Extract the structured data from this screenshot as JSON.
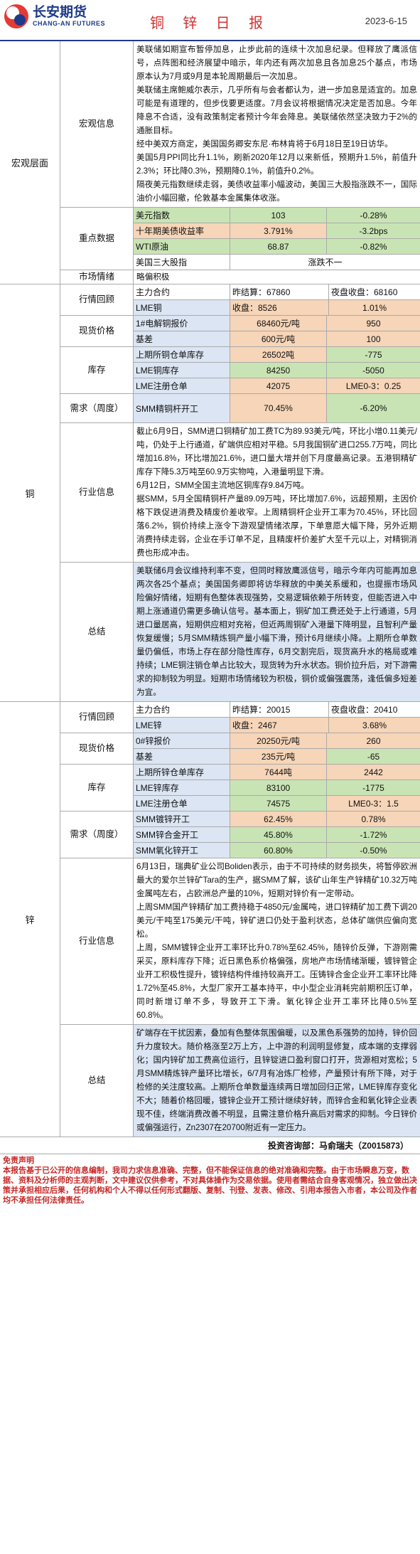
{
  "header": {
    "company_cn": "长安期货",
    "company_en": "CHANG-AN FUTURES",
    "title": "铜 锌 日 报",
    "date": "2023-6-15"
  },
  "macro": {
    "section_label": "宏观层面",
    "news_label": "宏观信息",
    "news_paragraphs": [
      "美联储如期宣布暂停加息，止步此前的连续十次加息纪录。但释放了鹰派信号，点阵图和经济展望中暗示，年内还有两次加息且各加息25个基点，市场原本认为7月或9月是本轮周期最后一次加息。",
      "美联储主席鲍威尔表示，几乎所有与会者都认为，进一步加息是适宜的。加息可能是有道理的，但步伐要更适度。7月会议将根据情况决定是否加息。今年降息不合适，没有政策制定者预计今年会降息。美联储依然坚决致力于2%的通胀目标。",
      "经中美双方商定，美国国务卿安东尼·布林肯将于6月18日至19日访华。",
      "美国5月PPI同比升1.1%，刷新2020年12月以来新低，预期升1.5%，前值升2.3%；环比降0.3%，预期降0.1%，前值升0.2%。",
      "隔夜美元指数继续走弱，美债收益率小幅波动，美国三大股指涨跌不一，国际油价小幅回撤，伦敦基本金属集体收涨。"
    ],
    "key_label": "重点数据",
    "key_rows": [
      {
        "name": "美元指数",
        "value": "103",
        "change": "-0.28%"
      },
      {
        "name": "十年期美债收益率",
        "value": "3.791%",
        "change": "-3.2bps"
      },
      {
        "name": "WTI原油",
        "value": "68.87",
        "change": "-0.82%"
      },
      {
        "name": "美国三大股指",
        "value": "涨跌不一"
      }
    ],
    "sentiment_label": "市场情绪",
    "sentiment_value": "略偏积极"
  },
  "copper": {
    "section_label": "铜",
    "quote_label": "行情回顾",
    "quote_rows": [
      {
        "c1": "主力合约",
        "c2": "昨结算：67860",
        "c3": "夜盘收盘：68160"
      },
      {
        "c1": "LME铜",
        "c2": "收盘：8526",
        "c3": "1.01%"
      }
    ],
    "spot_label": "现货价格",
    "spot_rows": [
      {
        "c1": "1#电解铜报价",
        "c2": "68460元/吨",
        "c3": "950"
      },
      {
        "c1": "基差",
        "c2": "600元/吨",
        "c3": "100"
      }
    ],
    "stock_label": "库存",
    "stock_rows": [
      {
        "c1": "上期所铜仓单库存",
        "c2": "26502吨",
        "c3": "-775"
      },
      {
        "c1": "LME铜库存",
        "c2": "84250",
        "c3": "-5050"
      },
      {
        "c1": "LME注册仓单",
        "c2": "42075",
        "c3": "LME0-3：0.25"
      }
    ],
    "demand_label": "需求（周度）",
    "demand_rows": [
      {
        "c1": "SMM精铜杆开工",
        "c2": "70.45%",
        "c3": "-6.20%"
      }
    ],
    "industry_label": "行业信息",
    "industry_paragraphs": [
      "截止6月9日，SMM进口铜精矿加工费TC为89.93美元/吨，环比小增0.11美元/吨，仍处于上行通道，矿端供应相对平稳。5月我国铜矿进口255.7万吨，同比增加16.8%，环比增加21.6%，进口量大增并创下月度最高记录。五港铜精矿库存下降5.3万吨至60.9万实物吨，入港量明显下滑。",
      "6月12日，SMM全国主流地区铜库存9.84万吨。",
      "据SMM，5月全国精铜杆产量89.09万吨，环比增加7.6%，远超预期，主因价格下跌促进消费及精废价差收窄。上周精铜杆企业开工率为70.45%，环比回落6.2%，铜价持续上涨令下游观望情绪浓厚，下单意愿大幅下降，另外近期消费持续走弱，企业在手订单不足，且精废杆价差扩大至千元以上，对精铜消费也形成冲击。"
    ],
    "summary_label": "总结",
    "summary_paragraphs": [
      "美联储6月会议维持利率不变，但同时释放鹰派信号，暗示今年内可能再加息两次各25个基点；美国国务卿即将访华释放的中美关系缓和，也提振市场风险偏好情绪，短期有色整体表现强势，交易逻辑依赖于所转变，但能否进入中期上涨通道仍需更多确认信号。基本面上，铜矿加工费还处于上行通道，5月进口量居高，短期供应相对充裕，但近两周铜矿入港量下降明显，且智利产量恢复缓慢；5月SMM精炼铜产量小幅下滑，预计6月继续小降。上期所仓单数量仍偏低，市场上存在部分隐性库存，6月交割完后，现货高升水的格局或难持续；LME铜注销仓单占比较大，现货转为升水状态。铜价拉升后，对下游需求的抑制较为明显。短期市场情绪较为积极，铜价或偏强震荡，逢低偏多短差为宜。"
    ]
  },
  "zinc": {
    "section_label": "锌",
    "quote_label": "行情回顾",
    "quote_rows": [
      {
        "c1": "主力合约",
        "c2": "昨结算：20015",
        "c3": "夜盘收盘：20410"
      },
      {
        "c1": "LME锌",
        "c2": "收盘：2467",
        "c3": "3.68%"
      }
    ],
    "spot_label": "现货价格",
    "spot_rows": [
      {
        "c1": "0#锌报价",
        "c2": "20250元/吨",
        "c3": "260"
      },
      {
        "c1": "基差",
        "c2": "235元/吨",
        "c3": "-65"
      }
    ],
    "stock_label": "库存",
    "stock_rows": [
      {
        "c1": "上期所锌仓单库存",
        "c2": "7644吨",
        "c3": "2442"
      },
      {
        "c1": "LME锌库存",
        "c2": "83100",
        "c3": "-1775"
      },
      {
        "c1": "LME注册仓单",
        "c2": "74575",
        "c3": "LME0-3：1.5"
      }
    ],
    "demand_label": "需求（周度）",
    "demand_rows": [
      {
        "c1": "SMM镀锌开工",
        "c2": "62.45%",
        "c3": "0.78%"
      },
      {
        "c1": "SMM锌合金开工",
        "c2": "45.80%",
        "c3": "-1.72%"
      },
      {
        "c1": "SMM氧化锌开工",
        "c2": "60.80%",
        "c3": "-0.50%"
      }
    ],
    "industry_label": "行业信息",
    "industry_paragraphs": [
      "6月13日，瑞典矿业公司Boliden表示，由于不可持续的财务损失，将暂停欧洲最大的爱尔兰锌矿Tara的生产，据SMM了解，该矿山年生产锌精矿10.32万吨金属吨左右，占欧洲总产量的10%，短期对锌价有一定带动。",
      "上周SMM国产锌精矿加工费持稳于4850元/金属吨，进口锌精矿加工费下调20美元/干吨至175美元/干吨，锌矿进口仍处于盈利状态，总体矿端供应偏向宽松。",
      "上周，SMM镀锌企业开工率环比升0.78%至62.45%，随锌价反弹，下游刚需采买，原料库存下降；近日黑色系价格偏强，房地产市场情绪渐暖，镀锌管企业开工积极性提升，镀锌结构件维持较高开工。压铸锌合金企业开工率环比降1.72%至45.8%，大型厂家开工基本持平，中小型企业消耗完前期积压订单，同时新增订单不多，导致开工下滑。氧化锌企业开工率环比降0.5%至60.8%。"
    ],
    "summary_label": "总结",
    "summary_paragraphs": [
      "矿端存在干扰因素，叠加有色整体氛围偏暖，以及黑色系强势的加持，锌价回升力度较大。随价格涨至2万上方，上中游的利润明显修复，成本端的支撑弱化；国内锌矿加工费高位运行，且锌锭进口盈利窗口打开，货源相对宽松；5月SMM精炼锌产量环比增长，6/7月有冶炼厂检修，产量预计有所下降，对于检修的关注度较高。上期所仓单数量连续两日增加回归正常，LME锌库存变化不大；随着价格回暖，镀锌企业开工预计继续好转，而锌合金和氧化锌企业表现不佳，终端消费改善不明显，且需注意价格升高后对需求的抑制。今日锌价或偏强运行，Zn2307在20700附近有一定压力。"
    ]
  },
  "footer": {
    "signature": "投资咨询部：马俞瑞夫（Z0015873）",
    "disclaimer_title": "免责声明",
    "disclaimer_text": "本报告基于已公开的信息编制，我司力求信息准确、完整，但不能保证信息的绝对准确和完整。由于市场瞬息万变，数据、资料及分析师的主观判断，文中建议仅供参考，不对具体操作为交易依据。使用者需结合自身客观情况，独立做出决策并承担相应后果，任何机构和个人不得以任何形式翻版、复制、刊登、发表、修改、引用本报告入市者，本公司及作者均不承担任何法律责任。"
  }
}
